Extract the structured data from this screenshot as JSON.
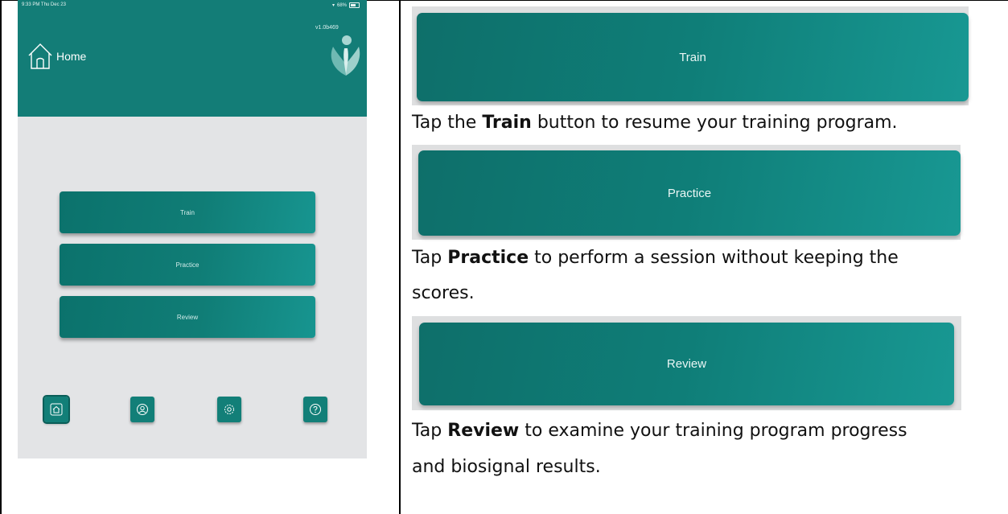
{
  "phone": {
    "status_time": "9:33 PM  Thu Dec 23",
    "status_battery": "68%",
    "version": "v1.0b469",
    "home_label": "Home",
    "menu": {
      "train": "Train",
      "practice": "Practice",
      "review": "Review"
    },
    "tabs": [
      "home-icon",
      "profile-icon",
      "settings-icon",
      "help-icon"
    ],
    "accent_color": "#137d77"
  },
  "guide": {
    "train_button": "Train",
    "train_pre": "Tap the ",
    "train_bold": "Train",
    "train_post": " button to resume your training program.",
    "practice_button": "Practice",
    "practice_pre": "Tap ",
    "practice_bold": "Practice",
    "practice_post": " to perform a session without keeping the",
    "practice_line2": "scores.",
    "review_button": "Review",
    "review_pre": "Tap ",
    "review_bold": "Review",
    "review_post": " to examine your training program progress",
    "review_line2": "and biosignal results."
  }
}
